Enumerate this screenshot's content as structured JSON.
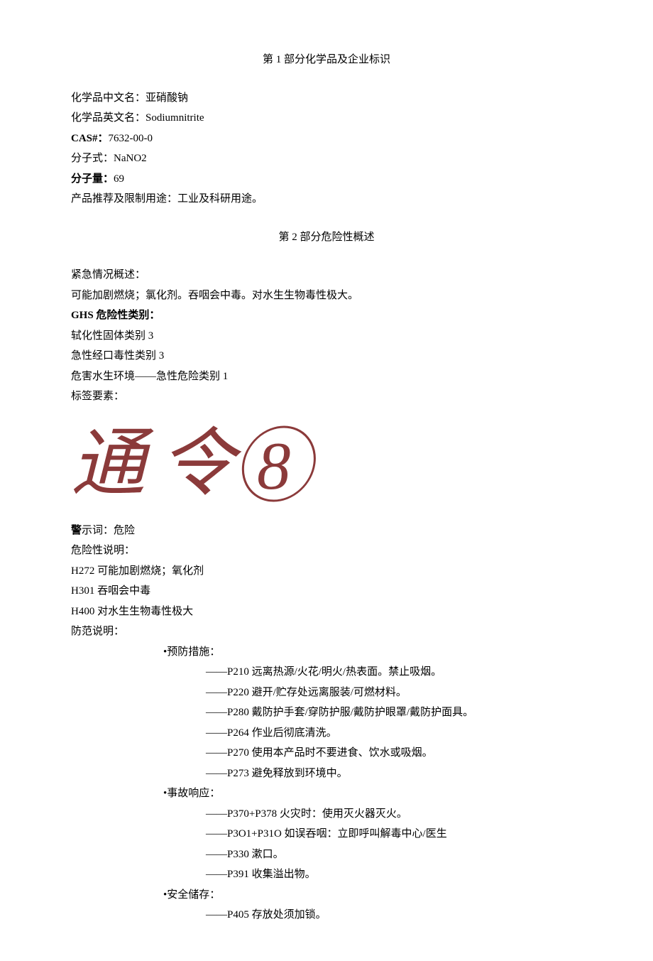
{
  "section1": {
    "title": "第 1 部分化学品及企业标识",
    "name_cn_label": "化学品中文名：",
    "name_cn": "亚硝酸钠",
    "name_en_label": "化学品英文名：",
    "name_en": "Sodiumnitrite",
    "cas_label": "CAS#：",
    "cas": "7632-00-0",
    "formula_label": "分子式：",
    "formula": "NaNO2",
    "mw_label": "分子量：",
    "mw": "69",
    "use_label": "产品推荐及限制用途：",
    "use": "工业及科研用途。"
  },
  "section2": {
    "title": "第 2 部分危险性概述",
    "emergency_label": "紧急情况概述：",
    "emergency_text": "可能加剧燃烧；氯化剂。吞咽会中毒。对水生生物毒性极大。",
    "ghs_label": "GHS 危险性类别：",
    "ghs_cat1": "轼化性固体类别 3",
    "ghs_cat2": "急性经口毒性类别 3",
    "ghs_cat3": "危害水生环境——急性危险类别 1",
    "label_elements": "标签要素：",
    "pictogram_text": "通令⑧",
    "signal_label": "警",
    "signal_rest": "示词：危险",
    "hazard_label": "危险性说明：",
    "h272": "H272 可能加剧燃烧；氧化剂",
    "h301": "H301 吞咽会中毒",
    "h400": "H400 对水生生物毒性极大",
    "precaution_label": "防范说明：",
    "prevention_header": "•预防措施：",
    "p210": "——P210 远离热源/火花/明火/热表面。禁止吸烟。",
    "p220": "——P220 避开/贮存处远离服装/可燃材料。",
    "p280": "——P280 戴防护手套/穿防护服/戴防护眼罩/戴防护面具。",
    "p264": "——P264 作业后彻底清洗。",
    "p270": "——P270 使用本产品时不要进食、饮水或吸烟。",
    "p273": "——P273 避免释放到环境中。",
    "response_header": "•事故响应：",
    "p370_378": "——P370+P378 火灾时：使用灭火器灭火。",
    "p301_310": "——P3O1+P31O 如误吞咽：立即呼叫解毒中心/医生",
    "p330": "——P330 漱口。",
    "p391": "——P391 收集溢出物。",
    "storage_header": "•安全储存：",
    "p405": "——P405 存放处须加锁。"
  }
}
